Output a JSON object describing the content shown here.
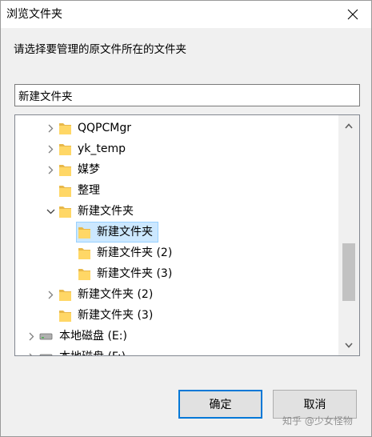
{
  "window": {
    "title": "浏览文件夹",
    "close_icon": "close-icon"
  },
  "instruction": "请选择要管理的原文件所在的文件夹",
  "folder_name_value": "新建文件夹",
  "tree": {
    "items": [
      {
        "label": "QQPCMgr",
        "expander": "collapsed",
        "icon": "folder-icon"
      },
      {
        "label": "yk_temp",
        "expander": "collapsed",
        "icon": "folder-icon"
      },
      {
        "label": "媒梦",
        "expander": "collapsed",
        "icon": "folder-icon"
      },
      {
        "label": "整理",
        "expander": "none",
        "icon": "folder-icon"
      },
      {
        "label": "新建文件夹",
        "expander": "expanded",
        "icon": "folder-icon"
      },
      {
        "label": "新建文件夹",
        "expander": "none",
        "icon": "folder-icon",
        "selected": true
      },
      {
        "label": "新建文件夹 (2)",
        "expander": "none",
        "icon": "folder-icon"
      },
      {
        "label": "新建文件夹 (3)",
        "expander": "none",
        "icon": "folder-icon"
      },
      {
        "label": "新建文件夹 (2)",
        "expander": "collapsed",
        "icon": "folder-icon"
      },
      {
        "label": "新建文件夹 (3)",
        "expander": "none",
        "icon": "folder-icon"
      },
      {
        "label": "本地磁盘 (E:)",
        "expander": "collapsed",
        "icon": "drive-icon"
      },
      {
        "label": "本地磁盘 (F:)",
        "expander": "collapsed",
        "icon": "drive-icon"
      }
    ]
  },
  "buttons": {
    "ok": "确定",
    "cancel": "取消"
  },
  "watermark": "知乎 @少女怪物",
  "colors": {
    "selection_bg": "#cce8ff",
    "selection_border": "#99d1ff",
    "ok_border": "#0078d7",
    "folder_yellow": "#ffd766"
  }
}
